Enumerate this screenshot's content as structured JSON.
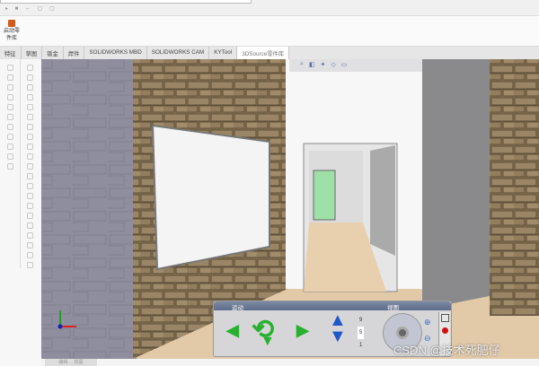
{
  "ribbon": {
    "launch_label": "启动零件库"
  },
  "tabs": [
    "特征",
    "草图",
    "钣金",
    "焊件",
    "SOLIDWORKS MBD",
    "SOLIDWORKS CAM",
    "KYTool",
    "3DSource零件库"
  ],
  "active_tab": "3DSource零件库",
  "walk_panel": {
    "motion_label": "运动",
    "view_label": "视图",
    "speed_top": "9",
    "speed_value": "5",
    "speed_bottom": "1"
  },
  "bottom_tab": "编辑 ... 视图",
  "watermark": "CSDN @技术死肥仔",
  "colors": {
    "stone": "#8a7656",
    "left_wall": "#8e8e9e",
    "floor": "#e2c9a8",
    "green_door": "#9fe0a8",
    "nav_green": "#27b12e",
    "nav_blue": "#1f58c8"
  }
}
